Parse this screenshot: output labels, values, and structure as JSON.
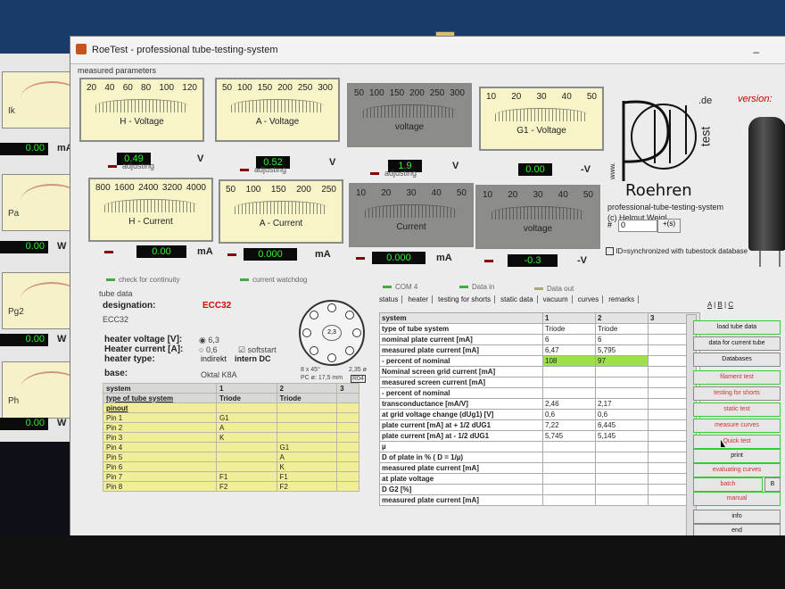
{
  "window": {
    "title": "RoeTest - professional tube-testing-system",
    "minimize_glyph": "–"
  },
  "section": {
    "measured_parameters": "measured parameters"
  },
  "meters": [
    {
      "name": "H - Voltage",
      "scale": [
        "20",
        "40",
        "60",
        "80",
        "100",
        "120"
      ],
      "reading": "0.49",
      "unit": "V",
      "note": "adjusting"
    },
    {
      "name": "A - Voltage",
      "scale": [
        "50",
        "100",
        "150",
        "200",
        "250",
        "300"
      ],
      "reading": "0.52",
      "unit": "V",
      "note": "adjusting"
    },
    {
      "name": "voltage",
      "scale": [
        "50",
        "100",
        "150",
        "200",
        "250",
        "300"
      ],
      "reading": "1.9",
      "unit": "V",
      "note": "adjusting"
    },
    {
      "name": "G1 - Voltage",
      "scale": [
        "10",
        "20",
        "30",
        "40",
        "50"
      ],
      "reading": "0.00",
      "unit": "-V"
    },
    {
      "name": "H - Current",
      "scale": [
        "800",
        "1600",
        "2400",
        "3200",
        "4000"
      ],
      "reading": "0.00",
      "unit": "mA"
    },
    {
      "name": "A - Current",
      "scale": [
        "50",
        "100",
        "150",
        "200",
        "250"
      ],
      "reading": "0.000",
      "unit": "mA"
    },
    {
      "name": "Current",
      "scale": [
        "10",
        "20",
        "30",
        "40",
        "50"
      ],
      "reading": "0.000",
      "unit": "mA"
    },
    {
      "name": "voltage",
      "scale": [
        "10",
        "20",
        "30",
        "40",
        "50"
      ],
      "reading": "-0.3",
      "unit": "-V"
    }
  ],
  "left_meters": [
    {
      "name": "Ik",
      "reading": "0.00",
      "unit": "mA"
    },
    {
      "name": "Pa",
      "reading": "0.00",
      "unit": "W"
    },
    {
      "name": "Pg2",
      "reading": "0.00",
      "unit": "W"
    },
    {
      "name": "Ph",
      "reading": "0.00",
      "unit": "W"
    }
  ],
  "status": {
    "continuity": "check for continuity",
    "watchdog": "current watchdog",
    "com": "COM 4",
    "data_in": "Data in",
    "data_out": "Data out"
  },
  "logo": {
    "line1": "Roehren",
    "line2": "professional-tube-testing-system",
    "line3": "(c) Helmut Weigl",
    "de": ".de",
    "www": "www.",
    "test": "test"
  },
  "version_label": "version:",
  "sync": {
    "number_label": "#",
    "number_value": "0",
    "plus_label": "+(s)",
    "sync_label": "ID=synchronized with tubestock database"
  },
  "tube_data": {
    "header": "tube data",
    "designation_label": "designation:",
    "designation_value": "ECC32",
    "type_text": "ECC32",
    "heater_voltage_label": "heater voltage [V]:",
    "heater_current_label": "Heater current [A]:",
    "heater_type_label": "heater type:",
    "hv_value": "6,3",
    "hc_value": "0,6",
    "softstart": "softstart",
    "heater_type_value": "indirekt",
    "heater_type_dc": "intern DC",
    "base_label": "base:",
    "base_value": "Oktal K8A",
    "socket_note1": "8 x 45°",
    "socket_note2": "PC ø: 17,5 mm",
    "socket_note3": "2,35 ø",
    "socket_note4": "R04",
    "socket_center": "2,3"
  },
  "pin_table": {
    "header": [
      "system",
      "1",
      "2",
      "3"
    ],
    "type_row": [
      "type of tube system",
      "Triode",
      "Triode",
      ""
    ],
    "rows": [
      [
        "pinout",
        "",
        "",
        ""
      ],
      [
        "Pin 1",
        "G1",
        "",
        ""
      ],
      [
        "Pin 2",
        "A",
        "",
        ""
      ],
      [
        "Pin 3",
        "K",
        "",
        ""
      ],
      [
        "Pin 4",
        "",
        "G1",
        ""
      ],
      [
        "Pin 5",
        "",
        "A",
        ""
      ],
      [
        "Pin 6",
        "",
        "K",
        ""
      ],
      [
        "Pin 7",
        "F1",
        "F1",
        ""
      ],
      [
        "Pin 8",
        "F2",
        "F2",
        ""
      ]
    ]
  },
  "tabs": [
    "status",
    "heater",
    "testing for shorts",
    "static data",
    "vacuum",
    "curves",
    "remarks"
  ],
  "data_table": {
    "header": [
      "system",
      "1",
      "2",
      "3"
    ],
    "rows": [
      [
        "type of tube system",
        "Triode",
        "Triode",
        ""
      ],
      [
        "nominal plate current [mA]",
        "6",
        "6",
        ""
      ],
      [
        "measured plate current [mA]",
        "6,47",
        "5,795",
        ""
      ],
      [
        "- percent of nominal",
        "108",
        "97",
        ""
      ],
      [
        "Nominal screen grid current [mA]",
        "",
        "",
        ""
      ],
      [
        "measured screen current [mA]",
        "",
        "",
        ""
      ],
      [
        "- percent of nominal",
        "",
        "",
        ""
      ],
      [
        "transconductance [mA/V]",
        "2,46",
        "2,17",
        ""
      ],
      [
        "at grid voltage change (dUg1) [V]",
        "0,6",
        "0,6",
        ""
      ],
      [
        "plate current [mA] at + 1/2 dUG1",
        "7,22",
        "6,445",
        ""
      ],
      [
        "plate current [mA] at - 1/2 dUG1",
        "5,745",
        "5,145",
        ""
      ],
      [
        "µ",
        "",
        "",
        ""
      ],
      [
        "D of plate in % ( D = 1/µ)",
        "",
        "",
        ""
      ],
      [
        "measured plate current [mA]",
        "",
        "",
        ""
      ],
      [
        "at plate voltage",
        "",
        "",
        ""
      ],
      [
        "D G2 [%]",
        "",
        "",
        ""
      ],
      [
        "measured plate current [mA]",
        "",
        "",
        ""
      ]
    ]
  },
  "abc": [
    "A",
    "B",
    "C"
  ],
  "buttons": [
    "load tube data",
    "data for current tube",
    "Databases",
    "filament test",
    "testing for shorts",
    "static test",
    "measure curves",
    "Quick test",
    "print",
    "evaluating curves",
    "batch",
    "manual",
    "info",
    "end"
  ],
  "batch_side": "B"
}
